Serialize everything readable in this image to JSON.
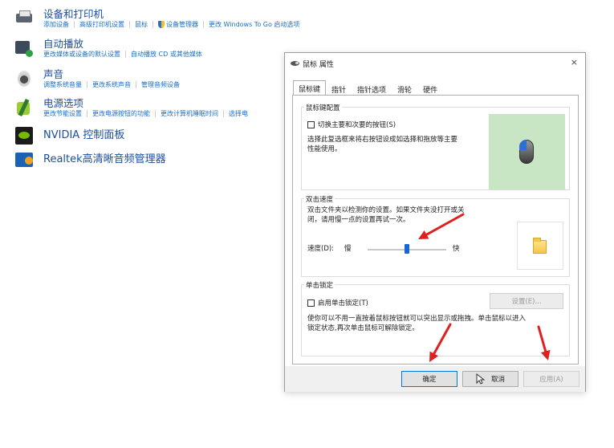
{
  "control_panel": {
    "items": [
      {
        "title": "设备和打印机",
        "icon": "printer-icon",
        "links": [
          "添加设备",
          "高级打印机设置",
          "鼠标",
          "设备管理器",
          "更改 Windows To Go 启动选项"
        ]
      },
      {
        "title": "自动播放",
        "icon": "autoplay-icon",
        "links": [
          "更改媒体或设备的默认设置",
          "自动播放 CD 或其他媒体"
        ]
      },
      {
        "title": "声音",
        "icon": "speaker-icon",
        "links": [
          "调整系统音量",
          "更改系统声音",
          "管理音频设备"
        ]
      },
      {
        "title": "电源选项",
        "icon": "power-icon",
        "links": [
          "更改节能设置",
          "更改电源按钮的功能",
          "更改计算机睡眠时间",
          "选择电"
        ]
      },
      {
        "title": "NVIDIA 控制面板",
        "icon": "nvidia-icon"
      },
      {
        "title": "Realtek高清晰音频管理器",
        "icon": "realtek-icon"
      }
    ]
  },
  "dialog": {
    "title": "鼠标 属性",
    "close_glyph": "×",
    "tabs": [
      "鼠标键",
      "指针",
      "指针选项",
      "滑轮",
      "硬件"
    ],
    "active_tab": "鼠标键",
    "button_config": {
      "label": "鼠标键配置",
      "checkbox": "切换主要和次要的按钮(S)",
      "checked": false,
      "description_line1": "选择此复选框来将右按钮设成如选择和拖放等主要",
      "description_line2": "性能使用。"
    },
    "double_click": {
      "label": "双击速度",
      "description_line1": "双击文件夹以检测你的设置。如果文件夹没打开或关",
      "description_line2": "闭，请用慢一点的设置再试一次。",
      "speed_label": "速度(D):",
      "slow": "慢",
      "fast": "快",
      "speed_fraction": 0.5
    },
    "click_lock": {
      "label": "单击锁定",
      "checkbox": "启用单击锁定(T)",
      "checked": false,
      "settings_button": "设置(E)...",
      "description_line1": "使你可以不用一直按着鼠标按钮就可以突出显示或拖拽。单击鼠标以进入",
      "description_line2": "锁定状态,再次单击鼠标可解除锁定。"
    },
    "buttons": {
      "ok": "确定",
      "cancel": "取消",
      "apply": "应用(A)"
    }
  },
  "annotation_color": "#e02020"
}
